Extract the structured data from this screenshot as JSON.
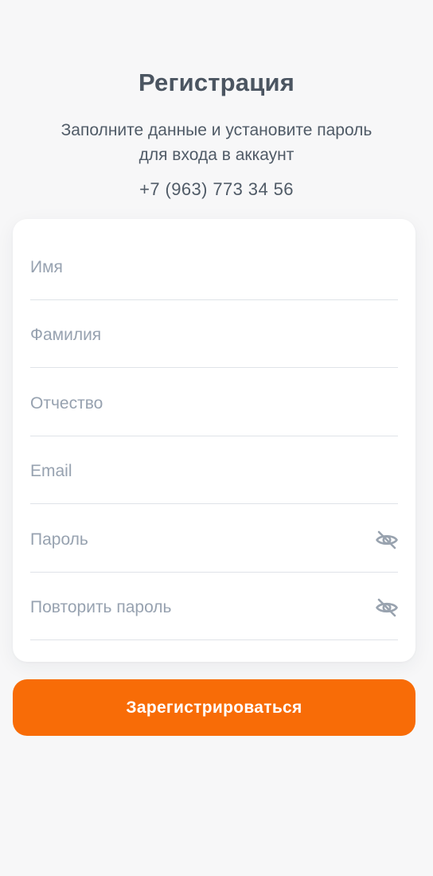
{
  "header": {
    "title": "Регистрация",
    "subtitle": "Заполните данные и установите пароль\nдля входа в аккаунт",
    "phone": "+7 (963) 773 34 56"
  },
  "form": {
    "fields": [
      {
        "placeholder": "Имя",
        "value": ""
      },
      {
        "placeholder": "Фамилия",
        "value": ""
      },
      {
        "placeholder": "Отчество",
        "value": ""
      },
      {
        "placeholder": "Email",
        "value": ""
      },
      {
        "placeholder": "Пароль",
        "value": "",
        "icon": "eye-off-icon"
      },
      {
        "placeholder": "Повторить пароль",
        "value": "",
        "icon": "eye-off-icon"
      }
    ]
  },
  "submit": {
    "label": "Зарегистрироваться"
  },
  "colors": {
    "background": "#f7f7f8",
    "card": "#ffffff",
    "accent": "#f86c07",
    "title": "#4b5561",
    "placeholder": "#97a2b0",
    "divider": "#dfe3e8",
    "icon": "#99a3af"
  }
}
